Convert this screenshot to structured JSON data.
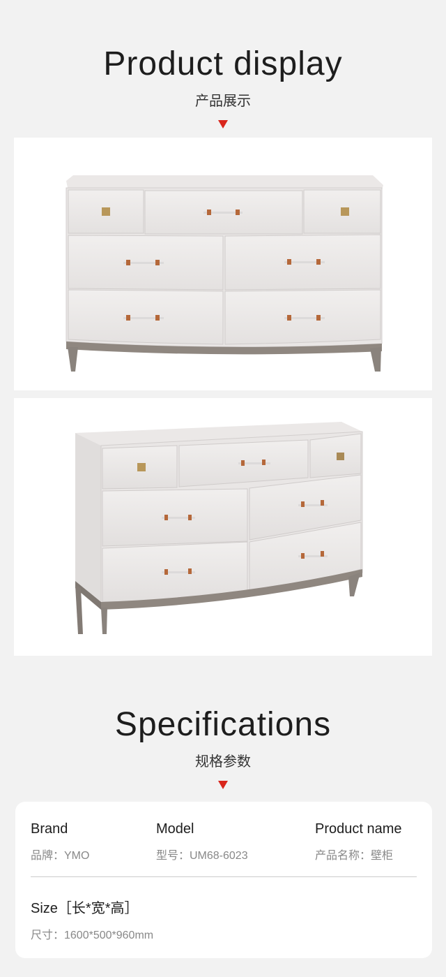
{
  "display": {
    "title": "Product display",
    "subtitle": "产品展示"
  },
  "photos": [
    {
      "name": "dresser-front-view"
    },
    {
      "name": "dresser-angled-view"
    }
  ],
  "specs": {
    "title": "Specifications",
    "subtitle": "规格参数",
    "brand": {
      "heading": "Brand",
      "value": "品牌：YMO"
    },
    "model": {
      "heading": "Model",
      "value": "型号：UM68-6023"
    },
    "product_name": {
      "heading": "Product name",
      "value": "产品名称：壁柜"
    },
    "size": {
      "heading": "Size［长*宽*高］",
      "value": "尺寸：1600*500*960mm"
    }
  },
  "colors": {
    "accent": "#d9261c",
    "background": "#f2f2f2",
    "card": "#ffffff"
  }
}
